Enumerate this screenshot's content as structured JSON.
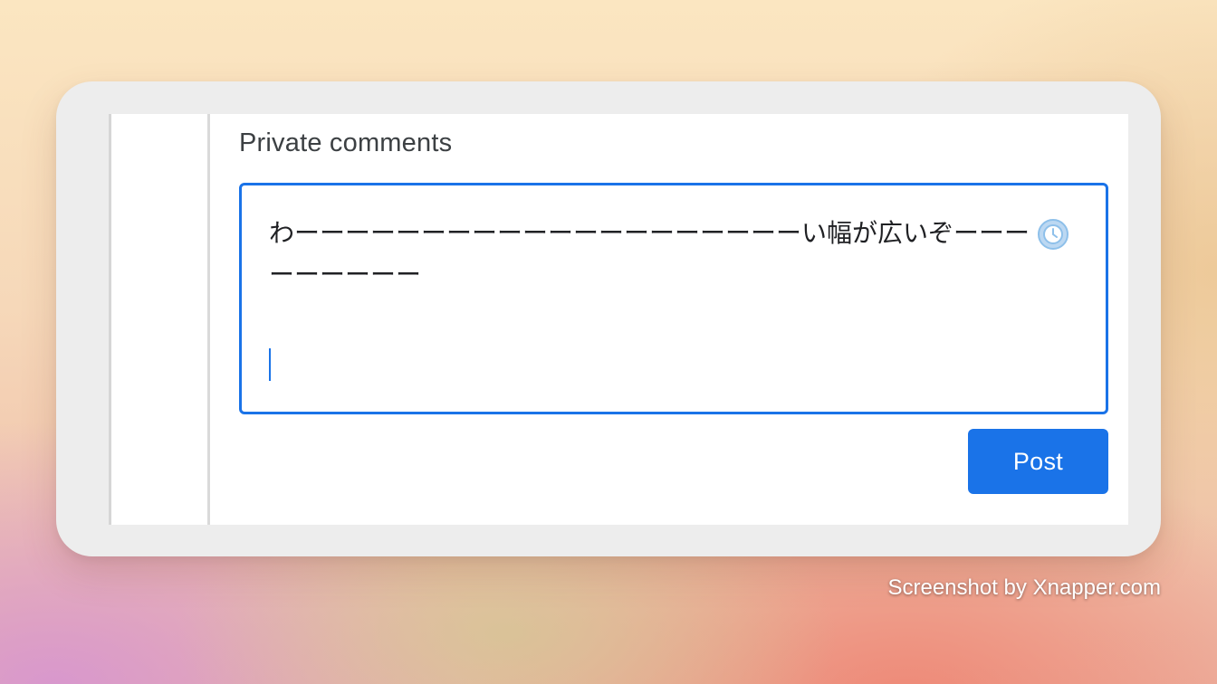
{
  "panel": {
    "title": "Private comments"
  },
  "comment": {
    "text": "わーーーーーーーーーーーーーーーーーーーーい幅が広いぞーーーーーーーーー"
  },
  "actions": {
    "post_label": "Post"
  },
  "watermark": {
    "text": "Screenshot by Xnapper.com"
  },
  "icons": {
    "autosave": "clock-icon"
  },
  "colors": {
    "accent": "#1a73e8",
    "title": "#3c4043"
  }
}
